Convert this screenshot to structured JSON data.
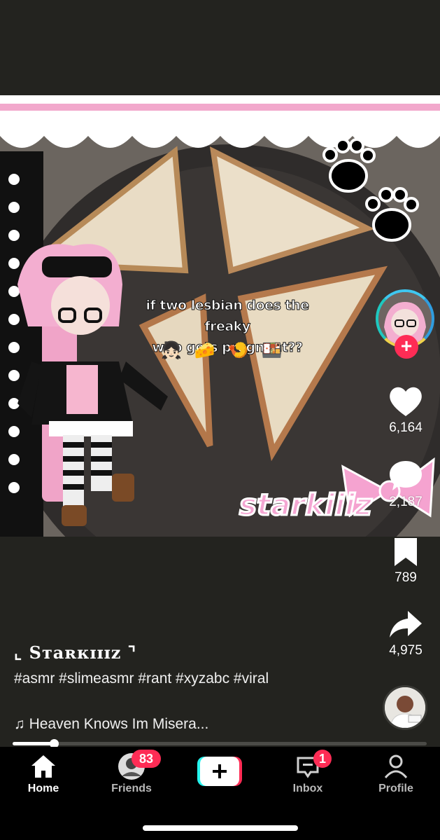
{
  "video": {
    "overlay_caption_line1": "if two lesbian does the freaky",
    "overlay_caption_line2": "who gets pregnant??",
    "overlay_emoji": "👧🏻🧀🍤🍱",
    "watermark": "starkiiiz"
  },
  "rail": {
    "likes": "6,164",
    "comments": "2,187",
    "saves": "789",
    "shares": "4,975"
  },
  "post": {
    "username": "⌞ Sтaʀкɪɪɪz ⌝",
    "caption": "#asmr #slimeasmr #rant #xyzabc #viral",
    "sound": "♫ Heaven Knows Im Misera...",
    "progress": 0.1
  },
  "nav": {
    "home": "Home",
    "friends": "Friends",
    "friends_badge": "83",
    "inbox": "Inbox",
    "inbox_badge": "1",
    "profile": "Profile"
  },
  "colors": {
    "background": "#23231f",
    "accent_red": "#fe2c55",
    "accent_cyan": "#25f4ee",
    "watermark_pink": "#f4a6d2"
  }
}
